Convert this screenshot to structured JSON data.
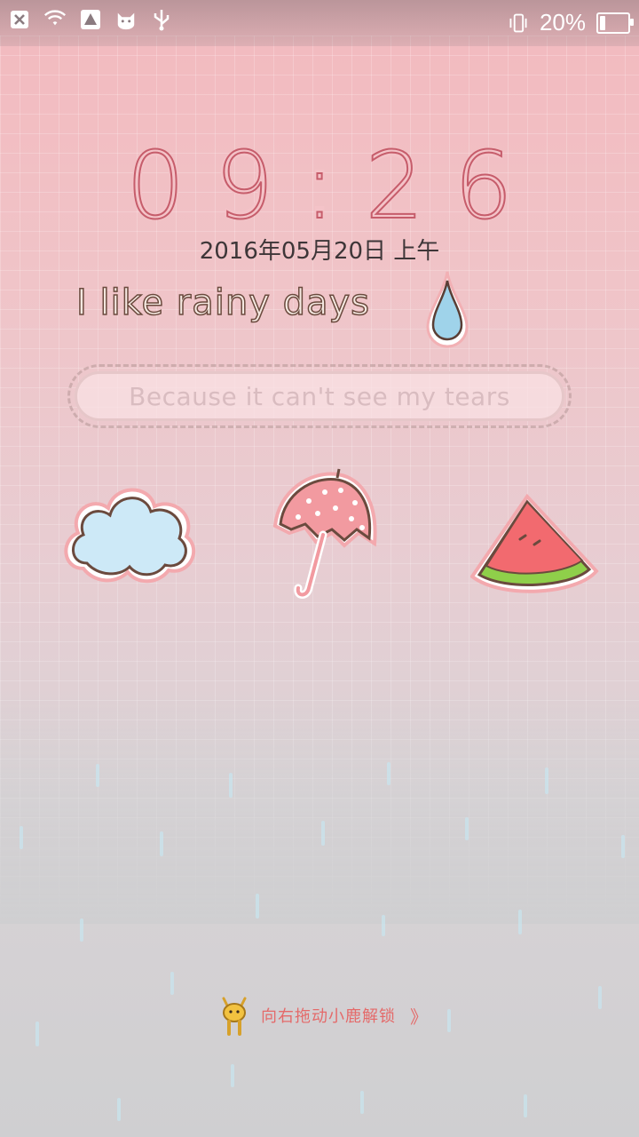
{
  "status_bar": {
    "battery_percent": "20%",
    "battery_level": 0.2,
    "icons": [
      "notification-x-icon",
      "wifi-icon",
      "warning-icon",
      "cat-icon",
      "usb-icon",
      "vibrate-icon",
      "battery-icon"
    ]
  },
  "lockscreen": {
    "time": "09:26",
    "date": "2016年05月20日 上午",
    "slogan": "I like rainy days",
    "subtitle": "Because it can't see my tears",
    "unlock_hint": "向右拖动小鹿解锁",
    "unlock_arrow": "》"
  },
  "colors": {
    "clock": "#e07f8b",
    "unlock_text": "#e46a6a",
    "cloud_fill": "#cde9f7",
    "umbrella_fill": "#f29aa0",
    "watermelon_flesh": "#f26a6f",
    "watermelon_rind": "#8fcf4a"
  }
}
